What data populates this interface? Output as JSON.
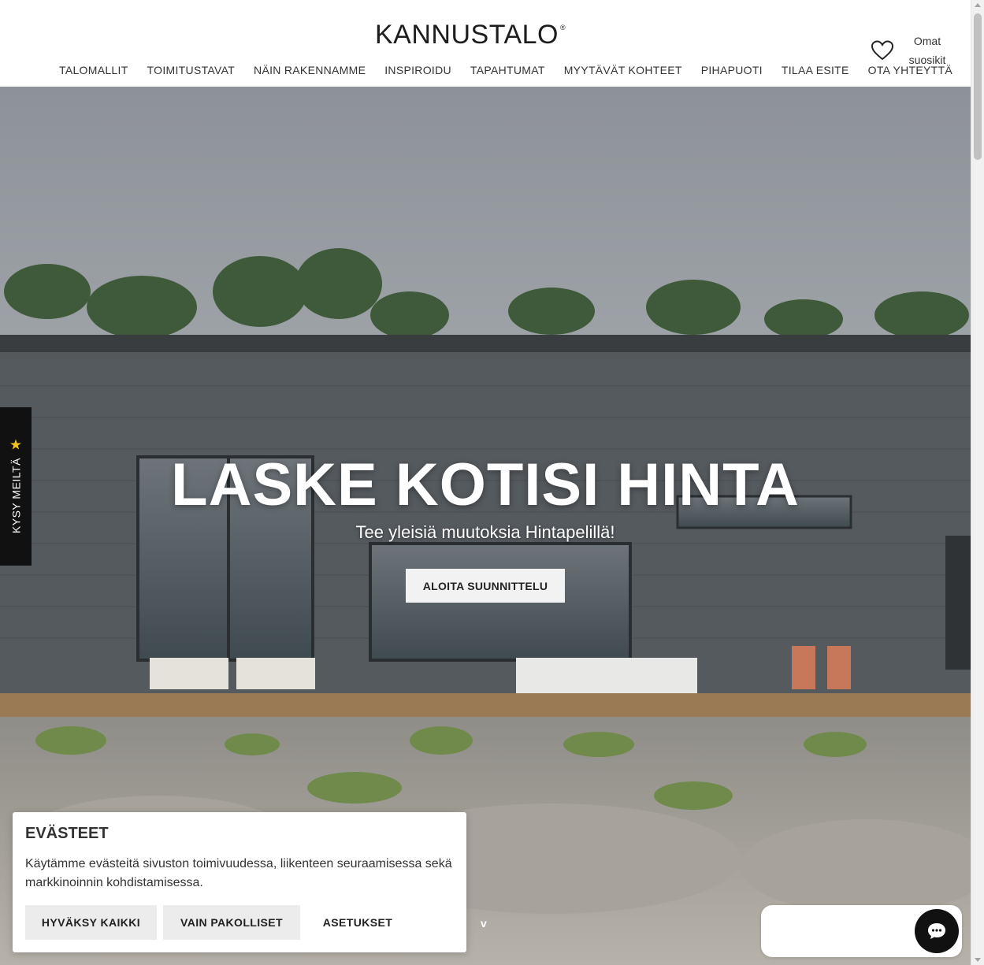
{
  "header": {
    "logo": "KANNUSTALO",
    "logo_mark": "®",
    "nav": [
      {
        "label": "TALOMALLIT"
      },
      {
        "label": "TOIMITUSTAVAT"
      },
      {
        "label": "NÄIN RAKENNAMME"
      },
      {
        "label": "INSPIROIDU"
      },
      {
        "label": "TAPAHTUMAT"
      },
      {
        "label": "MYYTÄVÄT KOHTEET"
      },
      {
        "label": "PIHAPUOTI"
      },
      {
        "label": "TILAA ESITE"
      },
      {
        "label": "OTA YHTEYTTÄ"
      }
    ],
    "favorites": {
      "line1": "Omat",
      "line2": "suosikit",
      "icon": "heart-icon"
    }
  },
  "hero": {
    "title": "LASKE KOTISI HINTA",
    "subtitle": "Tee yleisiä muutoksia Hintapelillä!",
    "cta": "ALOITA SUUNNITTELU",
    "scroll_indicator": "v"
  },
  "side_tab": {
    "label": "KYSY MEILTÄ",
    "icon": "star-icon",
    "icon_color": "#f5c518"
  },
  "cookie": {
    "title": "EVÄSTEET",
    "text": "Käytämme evästeitä sivuston toimivuudessa, liikenteen seuraamisessa sekä markkinoinnin kohdistamisessa.",
    "accept_all": "HYVÄKSY KAIKKI",
    "necessary_only": "VAIN PAKOLLISET",
    "settings": "ASETUKSET"
  },
  "chat": {
    "icon": "chat-icon"
  },
  "colors": {
    "button_light": "#ececec",
    "dark": "#111111",
    "accent_star": "#f5c518"
  }
}
